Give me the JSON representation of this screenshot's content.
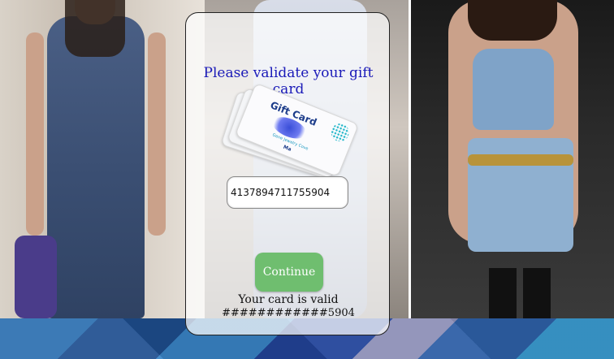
{
  "panel": {
    "title": "Please validate your gift card",
    "gift_card_image": {
      "label": "Gift Card",
      "subtext": "Gene Jewelry Cove",
      "logo_text": "Ma"
    },
    "card_number_value": "4137894711755904",
    "continue_label": "Continue",
    "status_text": "Your card is valid",
    "masked_number": "############5904"
  },
  "colors": {
    "title_text": "#1a1ab8",
    "button_bg": "#6fbe6f",
    "panel_bg": "rgba(255,255,255,0.72)"
  }
}
